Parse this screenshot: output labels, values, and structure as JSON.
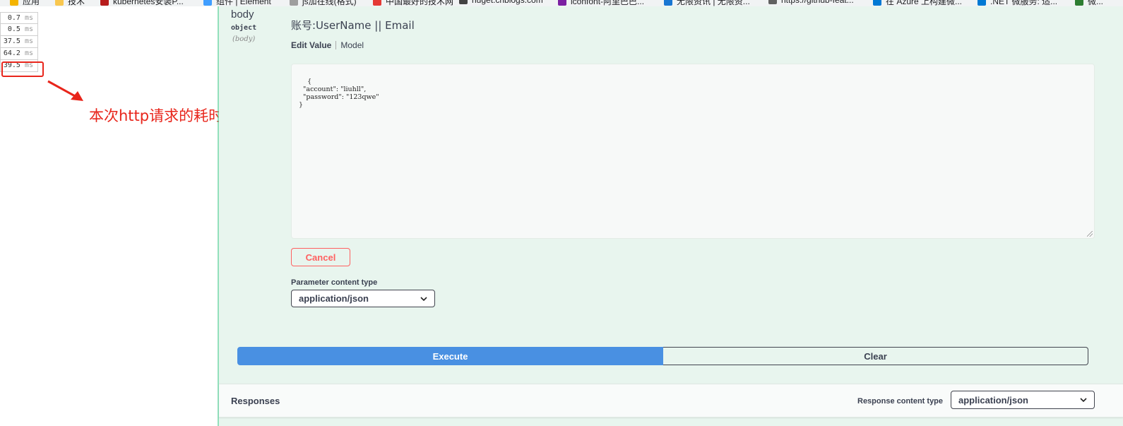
{
  "bookmarks": [
    {
      "label": "应用",
      "color": "#f4b400"
    },
    {
      "label": "技术",
      "color": "#f9c74f"
    },
    {
      "label": "kubernetes安装P...",
      "color": "#b71c1c"
    },
    {
      "label": "组件 | Element",
      "color": "#409eff"
    },
    {
      "label": "js加在线(格式)",
      "color": "#9e9e9e"
    },
    {
      "label": "中国最好的技术网",
      "color": "#e53935"
    },
    {
      "label": "nuget.cnblogs.com",
      "color": "#424242"
    },
    {
      "label": "iconfont-阿里巴巴...",
      "color": "#7b1fa2"
    },
    {
      "label": "无限资讯 | 无限资...",
      "color": "#1976d2"
    },
    {
      "label": "https://github-feat...",
      "color": "#616161"
    },
    {
      "label": "在 Azure 上构建微...",
      "color": "#0078d4"
    },
    {
      "label": ".NET 微服务: 适...",
      "color": "#0078d4"
    },
    {
      "label": "微...",
      "color": "#2e7d32"
    }
  ],
  "timings": [
    {
      "value": "0.7",
      "unit": "ms"
    },
    {
      "value": "0.5",
      "unit": "ms"
    },
    {
      "value": "37.5",
      "unit": "ms"
    },
    {
      "value": "64.2",
      "unit": "ms"
    },
    {
      "value": "39.5",
      "unit": "ms"
    }
  ],
  "annotation": "本次http请求的耗时",
  "annotation_color": "#e8251b",
  "parameter": {
    "name": "body",
    "type": "object",
    "in": "(body)",
    "description": "账号:UserName || Email"
  },
  "tabs": {
    "edit_value": "Edit Value",
    "model": "Model"
  },
  "body_value": "{\n  \"account\": \"liuhll\",\n  \"password\": \"123qwe\"\n}",
  "cancel_label": "Cancel",
  "parameter_content_type": {
    "label": "Parameter content type",
    "selected": "application/json"
  },
  "execute_label": "Execute",
  "clear_label": "Clear",
  "responses": {
    "title": "Responses",
    "content_type_label": "Response content type",
    "content_type_selected": "application/json"
  },
  "colors": {
    "accent_green": "#49cc90",
    "execute_blue": "#4990e2",
    "cancel_red": "#ff6060",
    "panel_bg": "#e8f5ee"
  }
}
